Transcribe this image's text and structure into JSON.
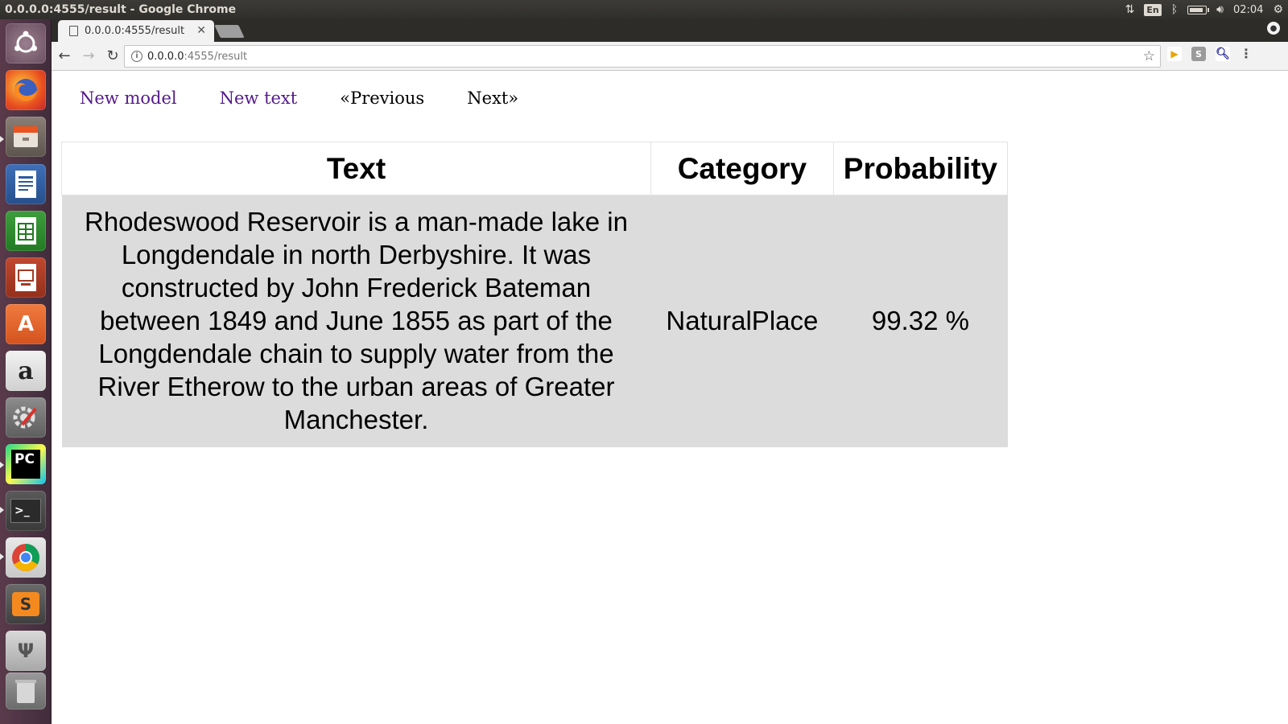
{
  "os": {
    "window_title": "0.0.0.0:4555/result - Google Chrome",
    "keyboard_layout": "En",
    "clock": "02:04",
    "indicator_icons": [
      "network-transfer-icon",
      "keyboard-layout-icon",
      "bluetooth-icon",
      "battery-icon",
      "volume-icon",
      "session-gear-icon"
    ],
    "launcher_apps": [
      "ubuntu-dash-icon",
      "firefox-icon",
      "files-icon",
      "libreoffice-writer-icon",
      "libreoffice-calc-icon",
      "libreoffice-impress-icon",
      "software-center-icon",
      "amazon-icon",
      "system-settings-icon",
      "pycharm-icon",
      "terminal-icon",
      "chrome-icon",
      "sublime-text-icon",
      "usb-drive-icon",
      "trash-icon"
    ]
  },
  "browser": {
    "tab_title": "0.0.0.0:4555/result",
    "url_host": "0.0.0.0",
    "url_rest": ":4555/result"
  },
  "page": {
    "links": {
      "new_model": "New model",
      "new_text": "New text",
      "previous": "«Previous",
      "next": "Next»"
    },
    "table": {
      "headers": [
        "Text",
        "Category",
        "Probability"
      ],
      "rows": [
        {
          "text": "Rhodeswood Reservoir is a man-made lake in Longdendale in north Derbyshire. It was constructed by John Frederick Bateman between 1849 and June 1855 as part of the Longdendale chain to supply water from the River Etherow to the urban areas of Greater Manchester.",
          "category": "NaturalPlace",
          "probability": "99.32 %"
        }
      ]
    }
  }
}
